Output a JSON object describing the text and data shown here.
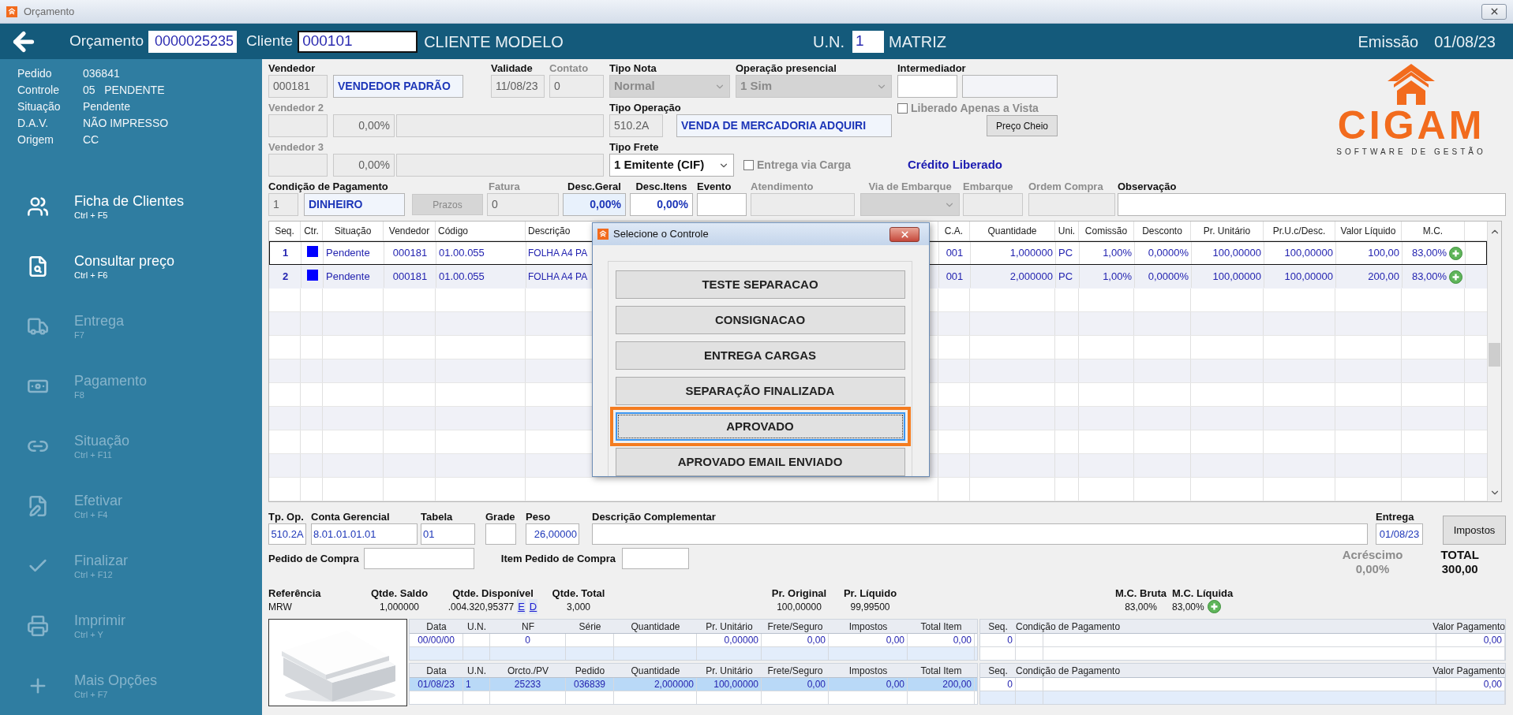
{
  "window": {
    "title": "Orçamento"
  },
  "header": {
    "orcamento_label": "Orçamento",
    "orcamento": "0000025235",
    "cliente_label": "Cliente",
    "cliente": "000101",
    "cliente_nome": "CLIENTE MODELO",
    "un_label": "U.N.",
    "un": "1",
    "un_nome": "MATRIZ",
    "emissao_label": "Emissão",
    "emissao": "01/08/23"
  },
  "sidebar": {
    "info": [
      {
        "label": "Pedido",
        "value": "036841"
      },
      {
        "label": "Controle",
        "value": "05   PENDENTE"
      },
      {
        "label": "Situação",
        "value": "Pendente"
      },
      {
        "label": "D.A.V.",
        "value": "NÃO IMPRESSO"
      },
      {
        "label": "Origem",
        "value": "CC"
      }
    ],
    "items": [
      {
        "label": "Ficha de Clientes",
        "shortcut": "Ctrl + F5",
        "disabled": false
      },
      {
        "label": "Consultar preço",
        "shortcut": "Ctrl + F6",
        "disabled": false
      },
      {
        "label": "Entrega",
        "shortcut": "F7",
        "disabled": true
      },
      {
        "label": "Pagamento",
        "shortcut": "F8",
        "disabled": true
      },
      {
        "label": "Situação",
        "shortcut": "Ctrl + F11",
        "disabled": true
      },
      {
        "label": "Efetivar",
        "shortcut": "Ctrl + F4",
        "disabled": true
      },
      {
        "label": "Finalizar",
        "shortcut": "Ctrl + F12",
        "disabled": true
      },
      {
        "label": "Imprimir",
        "shortcut": "Ctrl + Y",
        "disabled": true
      },
      {
        "label": "Mais Opções",
        "shortcut": "Ctrl + F7",
        "disabled": true
      }
    ]
  },
  "form": {
    "vendedor": {
      "label": "Vendedor",
      "code": "000181",
      "name": "VENDEDOR PADRÃO"
    },
    "validade": {
      "label": "Validade",
      "value": "11/08/23",
      "disabled": false,
      "readonly": true
    },
    "contato": {
      "label": "Contato",
      "value": "0",
      "disabled": true,
      "readonly": true
    },
    "tipo_nota": {
      "label": "Tipo Nota",
      "value": "Normal",
      "disabled": true
    },
    "operacao_presencial": {
      "label": "Operação presencial",
      "value": "1 Sim",
      "disabled": true
    },
    "intermediador": {
      "label": "Intermediador"
    },
    "vendedor_2": {
      "label": "Vendedor 2",
      "percent": "0,00%"
    },
    "vendedor_3": {
      "label": "Vendedor 3",
      "percent": "0,00%"
    },
    "tipo_operacao": {
      "label": "Tipo Operação",
      "code": "510.2A",
      "name": "VENDA DE MERCADORIA ADQUIRI"
    },
    "liberado_a_vista": {
      "label": "Liberado Apenas a Vista",
      "checked": false,
      "disabled": true
    },
    "preco_cheio": "Preço Cheio",
    "tipo_frete": {
      "label": "Tipo Frete",
      "value": "1 Emitente (CIF)",
      "disabled": false
    },
    "entrega_via_carga": {
      "label": "Entrega via Carga",
      "checked": false,
      "disabled": true
    },
    "credito": "Crédito Liberado",
    "condicao": {
      "label": "Condição de Pagamento",
      "code": "1",
      "name": "DINHEIRO"
    },
    "prazos": {
      "label": "Prazos",
      "disabled": true
    },
    "fatura": {
      "label": "Fatura",
      "value": "0",
      "disabled": true,
      "readonly": true
    },
    "desc_geral": {
      "label": "Desc.Geral",
      "value": "0,00%",
      "disabled": false,
      "readonly": false
    },
    "desc_itens": {
      "label": "Desc.Itens",
      "value": "0,00%",
      "disabled": false,
      "readonly": false
    },
    "evento": {
      "label": "Evento",
      "disabled": false,
      "readonly": false
    },
    "atendimento": {
      "label": "Atendimento",
      "disabled": true,
      "readonly": true
    },
    "via_embarque": {
      "label": "Via de Embarque",
      "disabled": true
    },
    "embarque": {
      "label": "Embarque",
      "disabled": true,
      "readonly": true
    },
    "ordem_compra": {
      "label": "Ordem Compra",
      "disabled": true,
      "readonly": true
    },
    "observacao": {
      "label": "Observação",
      "disabled": false,
      "readonly": false
    }
  },
  "logo": {
    "name": "CIGAM",
    "tagline": "SOFTWARE DE GESTÃO"
  },
  "table": {
    "columns": [
      "Seq.",
      "Ctr.",
      "Situação",
      "Vendedor",
      "Código",
      "Descrição",
      "C.A.",
      "Quantidade",
      "Uni.",
      "Comissão",
      "Desconto",
      "Pr. Unitário",
      "Pr.U.c/Desc.",
      "Valor Líquido",
      "M.C."
    ],
    "rows": [
      {
        "cells": [
          "1",
          null,
          "Pendente",
          "000181",
          "01.00.055",
          "FOLHA A4 PA",
          "001",
          "1,000000",
          "PC",
          "1,00%",
          "0,0000%",
          "100,00000",
          "100,00000",
          "100,00",
          "83,00%"
        ],
        "color": "#0000ff",
        "selected": true
      },
      {
        "cells": [
          "2",
          null,
          "Pendente",
          "000181",
          "01.00.055",
          "FOLHA A4 PA",
          "001",
          "2,000000",
          "PC",
          "1,00%",
          "0,0000%",
          "100,00000",
          "100,00000",
          "200,00",
          "83,00%"
        ],
        "color": "#0000ff",
        "selected": false
      }
    ]
  },
  "dialog": {
    "title": "Selecione o Controle",
    "options": [
      {
        "label": "TESTE SEPARACAO",
        "selected": false
      },
      {
        "label": "CONSIGNACAO",
        "selected": false
      },
      {
        "label": "ENTREGA CARGAS",
        "selected": false
      },
      {
        "label": "SEPARAÇÃO FINALIZADA",
        "selected": false
      },
      {
        "label": "APROVADO",
        "selected": true
      },
      {
        "label": "APROVADO EMAIL ENVIADO",
        "selected": false
      }
    ]
  },
  "detail": {
    "tp_op": {
      "label": "Tp. Op.",
      "value": "510.2A"
    },
    "conta_gerencial": {
      "label": "Conta Gerencial",
      "value": "8.01.01.01.01"
    },
    "tabela": {
      "label": "Tabela",
      "value": "01"
    },
    "grade": {
      "label": "Grade"
    },
    "peso": {
      "label": "Peso",
      "value": "26,00000"
    },
    "descricao_complementar": {
      "label": "Descrição Complementar"
    },
    "entrega": {
      "label": "Entrega",
      "value": "01/08/23"
    },
    "impostos": "Impostos",
    "pedido_compra": {
      "label": "Pedido de Compra"
    },
    "item_pedido_compra": {
      "label": "Item Pedido de Compra"
    },
    "acrescimo": {
      "label": "Acréscimo",
      "value": "0,00%"
    },
    "total": {
      "label": "TOTAL",
      "value": "300,00"
    }
  },
  "summary": [
    {
      "label": "Referência",
      "value": "MRW"
    },
    {
      "label": "Qtde. Saldo",
      "value": "1,000000"
    },
    {
      "label": "Qtde. Disponível",
      "value": ".004.320,95377",
      "links": [
        "E",
        "D"
      ]
    },
    {
      "label": "Qtde. Total",
      "value": "3,000"
    },
    {
      "label": "Pr. Original",
      "value": "100,00000"
    },
    {
      "label": "Pr. Líquido",
      "value": "99,99500"
    },
    {
      "label": "M.C. Bruta",
      "value": "83,00%"
    },
    {
      "label": "M.C. Líquida",
      "value": "83,00%"
    }
  ],
  "history": [
    {
      "columns": [
        "Data",
        "U.N.",
        "NF",
        "Série",
        "Quantidade",
        "Pr. Unitário",
        "Frete/Seguro",
        "Impostos",
        "Total Item"
      ],
      "rows": [
        {
          "cells": [
            "00/00/00",
            null,
            "0",
            null,
            null,
            "0,00000",
            "0,00",
            "0,00",
            "0,00"
          ],
          "selected": false
        }
      ]
    },
    {
      "columns": [
        "Data",
        "U.N.",
        "Orcto./PV",
        "Pedido",
        "Quantidade",
        "Pr. Unitário",
        "Frete/Seguro",
        "Impostos",
        "Total Item"
      ],
      "rows": [
        {
          "cells": [
            "01/08/23",
            "1",
            "25233",
            "036839",
            "2,000000",
            "100,00000",
            "0,00",
            "0,00",
            "200,00"
          ],
          "selected": true
        }
      ]
    }
  ],
  "payments": [
    {
      "columns": [
        "Seq.",
        "Condição de Pagamento",
        "Valor Pagamento"
      ],
      "rows": [
        {
          "cells": [
            "0",
            null,
            "0,00"
          ]
        }
      ]
    },
    {
      "columns": [
        "Seq.",
        "Condição de Pagamento",
        "Valor Pagamento"
      ],
      "rows": [
        {
          "cells": [
            "0",
            null,
            "0,00"
          ]
        }
      ]
    }
  ]
}
